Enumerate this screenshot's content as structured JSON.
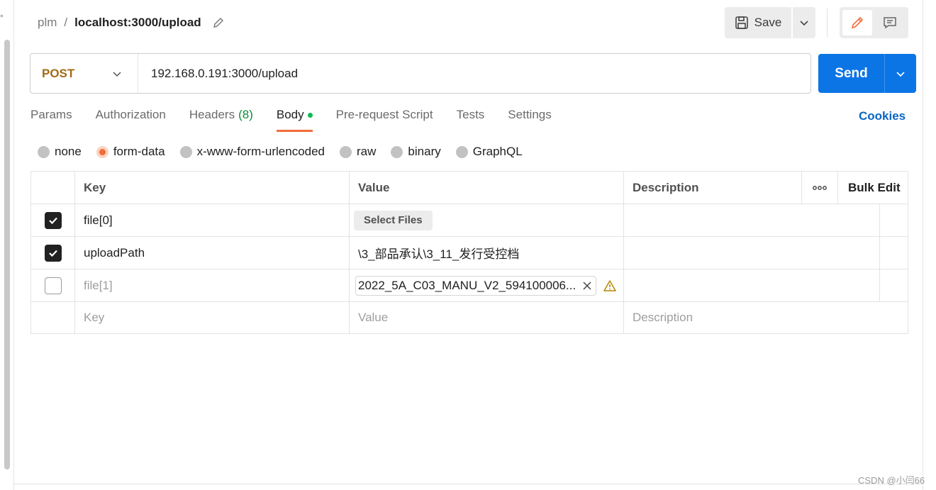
{
  "breadcrumb": {
    "parent": "plm",
    "separator": "/",
    "current": "localhost:3000/upload"
  },
  "toolbar": {
    "save_label": "Save"
  },
  "request": {
    "method": "POST",
    "url": "192.168.0.191:3000/upload",
    "send_label": "Send"
  },
  "tabs": {
    "params": "Params",
    "authorization": "Authorization",
    "headers": "Headers",
    "headers_count": "(8)",
    "body": "Body",
    "prerequest": "Pre-request Script",
    "tests": "Tests",
    "settings": "Settings",
    "cookies": "Cookies"
  },
  "body_types": {
    "none": "none",
    "form_data": "form-data",
    "urlencoded": "x-www-form-urlencoded",
    "raw": "raw",
    "binary": "binary",
    "graphql": "GraphQL",
    "selected": "form-data"
  },
  "table": {
    "headers": {
      "key": "Key",
      "value": "Value",
      "description": "Description",
      "bulk_edit": "Bulk Edit"
    },
    "rows": [
      {
        "key": "file[0]",
        "value": "Select Files",
        "checked": true
      },
      {
        "key": "uploadPath",
        "value": "\\3_部品承认\\3_11_发行受控档",
        "checked": true
      },
      {
        "key": "file[1]",
        "value": "2022_5A_C03_MANU_V2_594100006...",
        "checked": false
      }
    ],
    "placeholders": {
      "key": "Key",
      "value": "Value",
      "description": "Description"
    }
  },
  "colors": {
    "accent": "#f26b3a",
    "send": "#0b75e6",
    "method": "#a06a14",
    "link": "#0b65c2"
  },
  "watermark": "CSDN @小闫66"
}
